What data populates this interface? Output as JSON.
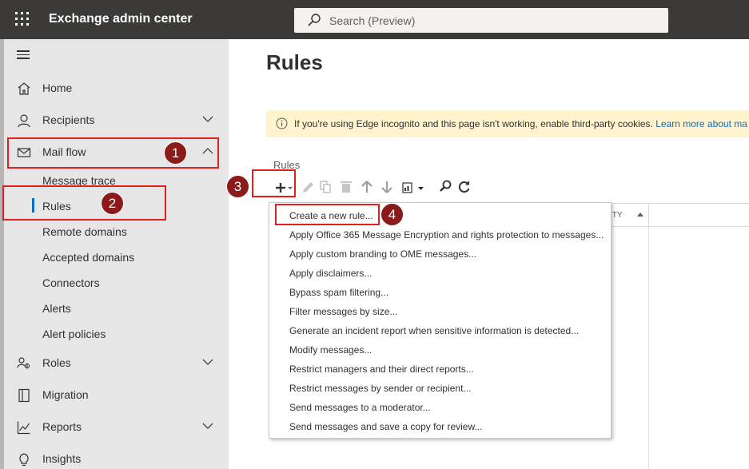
{
  "header": {
    "app_title": "Exchange admin center",
    "search_placeholder": "Search (Preview)"
  },
  "sidebar": {
    "items": [
      {
        "label": "Home",
        "icon": "home-icon"
      },
      {
        "label": "Recipients",
        "icon": "person-icon"
      },
      {
        "label": "Mail flow",
        "icon": "mail-icon"
      },
      {
        "label": "Roles",
        "icon": "roles-icon"
      },
      {
        "label": "Migration",
        "icon": "migration-icon"
      },
      {
        "label": "Reports",
        "icon": "chart-icon"
      },
      {
        "label": "Insights",
        "icon": "lightbulb-icon"
      }
    ],
    "mail_flow_subitems": [
      "Message trace",
      "Rules",
      "Remote domains",
      "Accepted domains",
      "Connectors",
      "Alerts",
      "Alert policies"
    ]
  },
  "page": {
    "title": "Rules",
    "banner_text": "If you're using Edge incognito and this page isn't working, enable third-party cookies.",
    "banner_link": "Learn more about ma",
    "section_label": "Rules",
    "grid_column": "ITY"
  },
  "toolbar": {
    "icons": [
      "add-icon",
      "edit-icon",
      "copy-icon",
      "delete-icon",
      "up-arrow-icon",
      "down-arrow-icon",
      "report-icon",
      "search-icon",
      "refresh-icon"
    ]
  },
  "new_rule_menu": {
    "items": [
      "Create a new rule...",
      "Apply Office 365 Message Encryption and rights protection to messages...",
      "Apply custom branding to OME messages...",
      "Apply disclaimers...",
      "Bypass spam filtering...",
      "Filter messages by size...",
      "Generate an incident report when sensitive information is detected...",
      "Modify messages...",
      "Restrict managers and their direct reports...",
      "Restrict messages by sender or recipient...",
      "Send messages to a moderator...",
      "Send messages and save a copy for review..."
    ]
  },
  "annotations": {
    "step1": "1",
    "step2": "2",
    "step3": "3",
    "step4": "4",
    "highlight_color": "#e02020",
    "badge_color": "#8b1a1a"
  },
  "colors": {
    "topbar": "#3b3a39",
    "sidebar": "#e6e6e6",
    "accent": "#0f6cbd",
    "banner": "#fff4ce"
  }
}
